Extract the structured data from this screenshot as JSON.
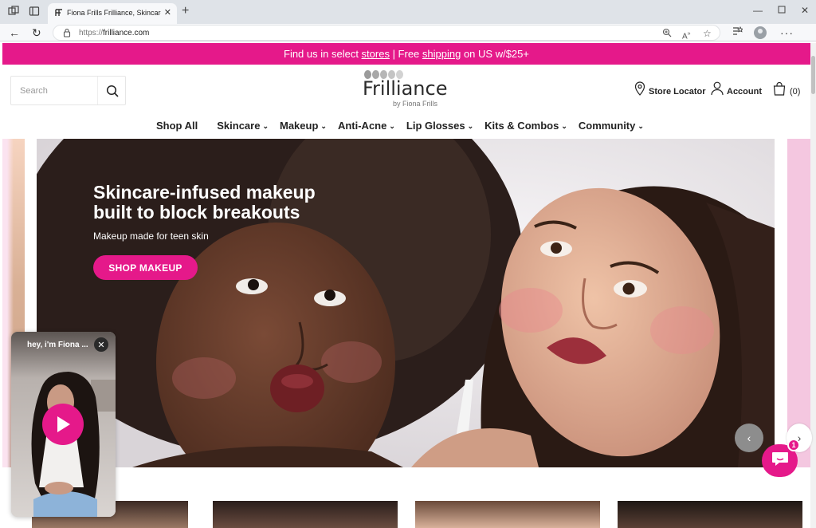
{
  "browser": {
    "tab_title": "Fiona Frills Frilliance, Skincare Ma",
    "url_protocol": "https://",
    "url_host": "frilliance.com",
    "icons": [
      "workspaces-icon",
      "tab-actions-icon",
      "close-icon",
      "new-tab-icon",
      "back-icon",
      "refresh-icon",
      "lock-icon",
      "zoom-icon",
      "read-aloud-icon",
      "favorite-icon",
      "collections-icon",
      "profile-icon",
      "more-icon",
      "minimize-icon",
      "maximize-icon",
      "window-close-icon"
    ]
  },
  "promo": {
    "prefix": "Find us in select ",
    "stores_link": "stores",
    "divider": " | Free ",
    "shipping_link": "shipping",
    "suffix": " on US w/$25+"
  },
  "header": {
    "search_placeholder": "Search",
    "logo_word": "Frilliance",
    "logo_by": "by Fiona Frills",
    "store_locator": "Store Locator",
    "account": "Account",
    "cart_count": "(0)"
  },
  "nav": [
    {
      "label": "Shop All",
      "has_menu": false
    },
    {
      "label": "Skincare",
      "has_menu": true
    },
    {
      "label": "Makeup",
      "has_menu": true
    },
    {
      "label": "Anti-Acne",
      "has_menu": true
    },
    {
      "label": "Lip Glosses",
      "has_menu": true
    },
    {
      "label": "Kits & Combos",
      "has_menu": true
    },
    {
      "label": "Community",
      "has_menu": true
    }
  ],
  "hero": {
    "heading_line1": "Skincare-infused makeup",
    "heading_line2": "built to block breakouts",
    "subheading": "Makeup made for teen skin",
    "cta": "SHOP MAKEUP",
    "prev_arrow": "‹",
    "next_arrow": "›"
  },
  "video": {
    "title": "hey, i'm Fiona ...",
    "close": "✕"
  },
  "chat": {
    "badge": "1"
  },
  "colors": {
    "brand_pink": "#e5198a",
    "text_dark": "#222222"
  }
}
